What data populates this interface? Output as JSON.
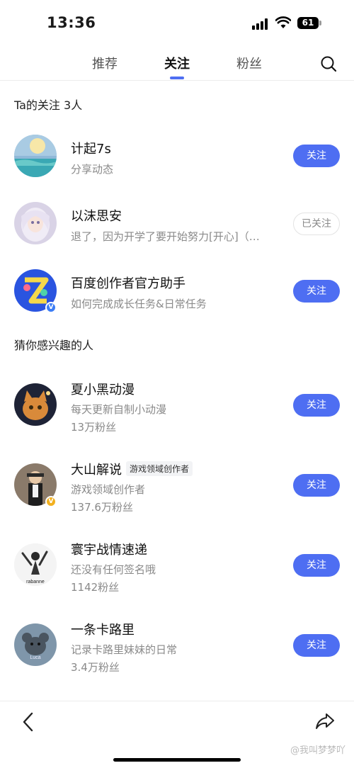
{
  "status": {
    "time": "13:36",
    "battery": "61"
  },
  "tabs": [
    {
      "label": "推荐",
      "active": false
    },
    {
      "label": "关注",
      "active": true
    },
    {
      "label": "粉丝",
      "active": false
    }
  ],
  "following_section": {
    "title": "Ta的关注 3人"
  },
  "following": [
    {
      "name": "计起7s",
      "desc": "分享动态",
      "button": "关注"
    },
    {
      "name": "以沫思安",
      "desc": "退了，因为开学了要开始努力[开心]（…",
      "button": "已关注"
    },
    {
      "name": "百度创作者官方助手",
      "desc": "如何完成成长任务&日常任务",
      "button": "关注",
      "badge": "V"
    }
  ],
  "suggest_section": {
    "title": "猜你感兴趣的人"
  },
  "suggested": [
    {
      "name": "夏小黑动漫",
      "desc": "每天更新自制小动漫",
      "fans": "13万粉丝",
      "button": "关注"
    },
    {
      "name": "大山解说",
      "tag": "游戏领域创作者",
      "desc": "游戏领域创作者",
      "fans": "137.6万粉丝",
      "button": "关注",
      "badge": "V"
    },
    {
      "name": "寰宇战情速递",
      "desc": "还没有任何签名哦",
      "fans": "1142粉丝",
      "button": "关注",
      "avatar_text": "rabanne"
    },
    {
      "name": "一条卡路里",
      "desc": "记录卡路里妹妹的日常",
      "fans": "3.4万粉丝",
      "button": "关注",
      "avatar_text": "Luca"
    }
  ],
  "watermark": "@我叫梦梦吖",
  "colors": {
    "accent": "#4e6ef2",
    "verified_blue": "#3b7cf5",
    "verified_gold": "#f2b01e"
  },
  "icons": {
    "search": "search-icon",
    "back": "back-arrow-icon",
    "share": "share-icon"
  }
}
